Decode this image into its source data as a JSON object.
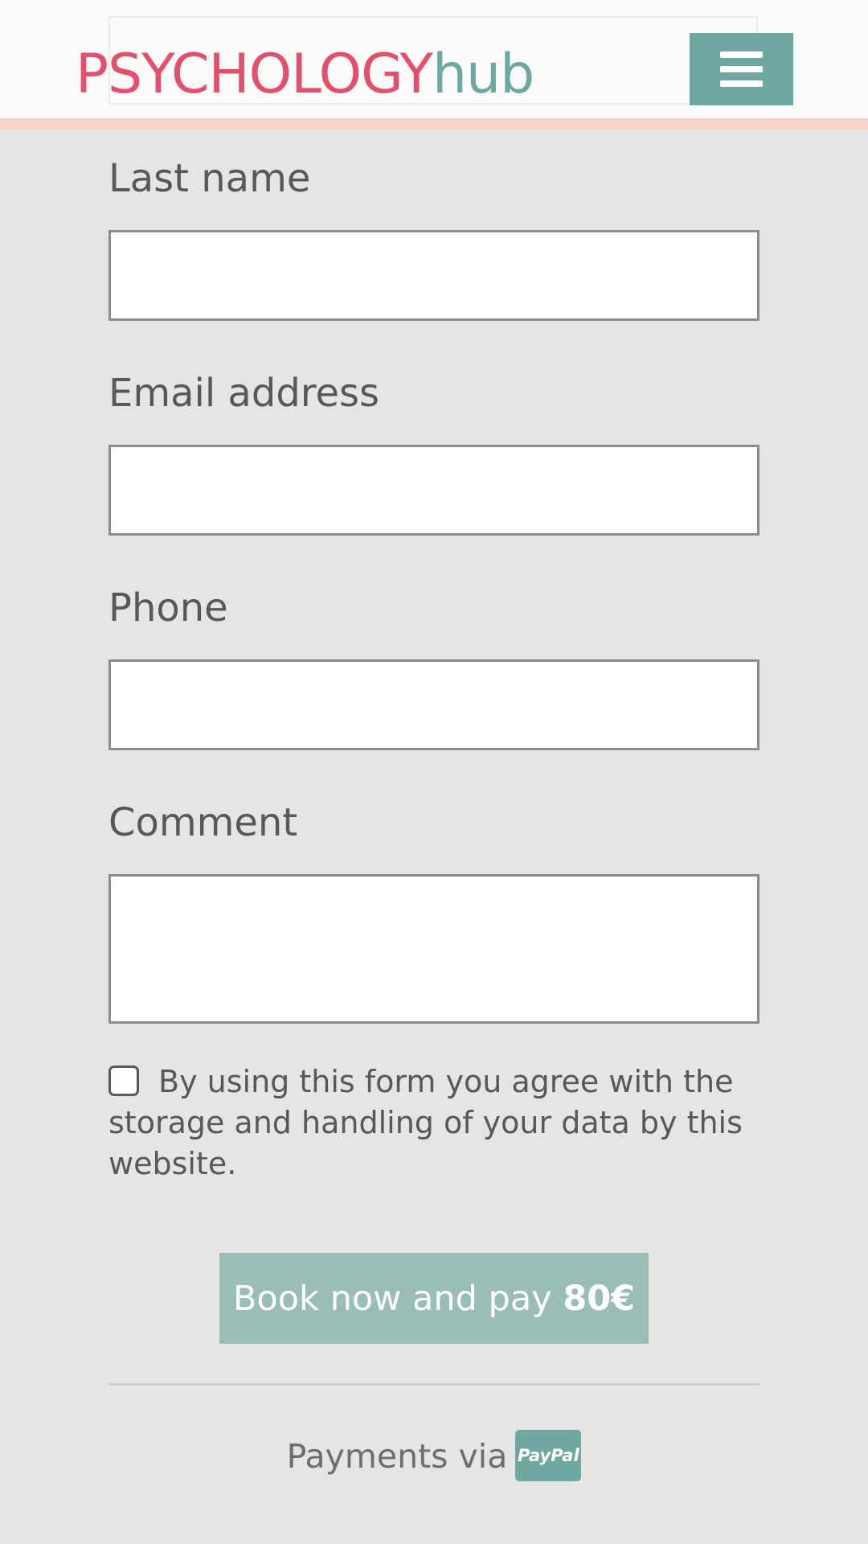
{
  "header": {
    "logo_primary": "PSYCHOLOGY",
    "logo_secondary": "hub",
    "menu_icon": "hamburger-menu-icon"
  },
  "form": {
    "last_name": {
      "label": "Last name",
      "value": "",
      "placeholder": ""
    },
    "email": {
      "label": "Email address",
      "value": "",
      "placeholder": ""
    },
    "phone": {
      "label": "Phone",
      "value": "",
      "placeholder": ""
    },
    "comment": {
      "label": "Comment",
      "value": "",
      "placeholder": ""
    },
    "consent": {
      "checked": false,
      "text": "By using this form you agree with the storage and handling of your data by this website."
    },
    "submit": {
      "label": "Book now and pay ",
      "price": "80€"
    }
  },
  "footer": {
    "payments_label": "Payments via",
    "paypal_badge": "PayPal"
  },
  "colors": {
    "brand_pink": "#e4506c",
    "brand_teal": "#6fa8a1",
    "button_teal_light": "#9abdb7",
    "header_stripe": "#f7d3cd",
    "page_background": "#e5e5e4"
  }
}
